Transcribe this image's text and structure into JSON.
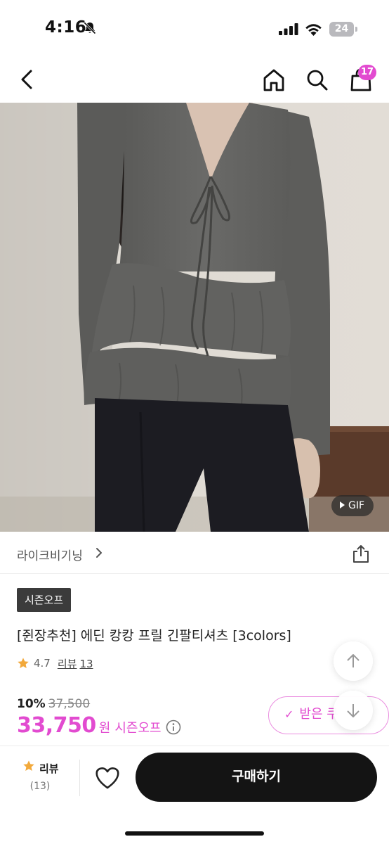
{
  "status_bar": {
    "time": "4:16",
    "battery": "24"
  },
  "nav": {
    "cart_count": "17"
  },
  "product_image": {
    "gif_label": "GIF"
  },
  "brand": {
    "name": "라이크비기닝"
  },
  "product": {
    "tag": "시즌오프",
    "title": "[쥔장추천] 에딘 캉캉 프릴 긴팔티셔츠 [3colors]",
    "rating": "4.7",
    "review_label": "리뷰",
    "review_count": "13",
    "discount_rate": "10%",
    "original_price": "37,500",
    "sale_price": "33,750",
    "price_unit": "원",
    "price_label": "시즌오프"
  },
  "coupon": {
    "label": "받은 쿠"
  },
  "bottom_bar": {
    "review_label": "리뷰",
    "review_count": "(13)",
    "buy_label": "구매하기"
  },
  "colors": {
    "accent": "#e24bd0",
    "dark": "#141414",
    "star": "#f2a93b"
  }
}
